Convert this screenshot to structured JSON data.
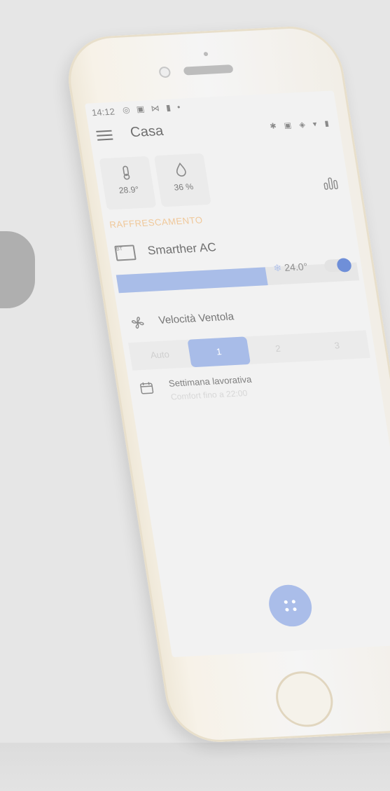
{
  "status_bar": {
    "time": "14:12",
    "left_icons": "◎ ▣ ⋈ ▮ •",
    "right_icons": "✱ ▣ ◈ ▾ ▮"
  },
  "header": {
    "title": "Casa",
    "menu_icon": "menu-icon"
  },
  "sensors": {
    "temperature": "28.9°",
    "humidity": "36 %"
  },
  "section": {
    "title": "RAFFRESCAMENTO"
  },
  "device": {
    "name": "Smarther AC",
    "icon_text": "BT",
    "setpoint": "24.0°",
    "setpoint_icon": "❄",
    "power_on": true,
    "bar_level": 0.62
  },
  "fan": {
    "label": "Velocità Ventola",
    "options": [
      "Auto",
      "1",
      "2",
      "3"
    ],
    "selected": "1"
  },
  "schedule": {
    "title": "Settimana lavorativa",
    "subtitle": "Comfort fino a 22:00"
  },
  "colors": {
    "accent": "#aabde9",
    "section_title": "#f0c89a"
  }
}
